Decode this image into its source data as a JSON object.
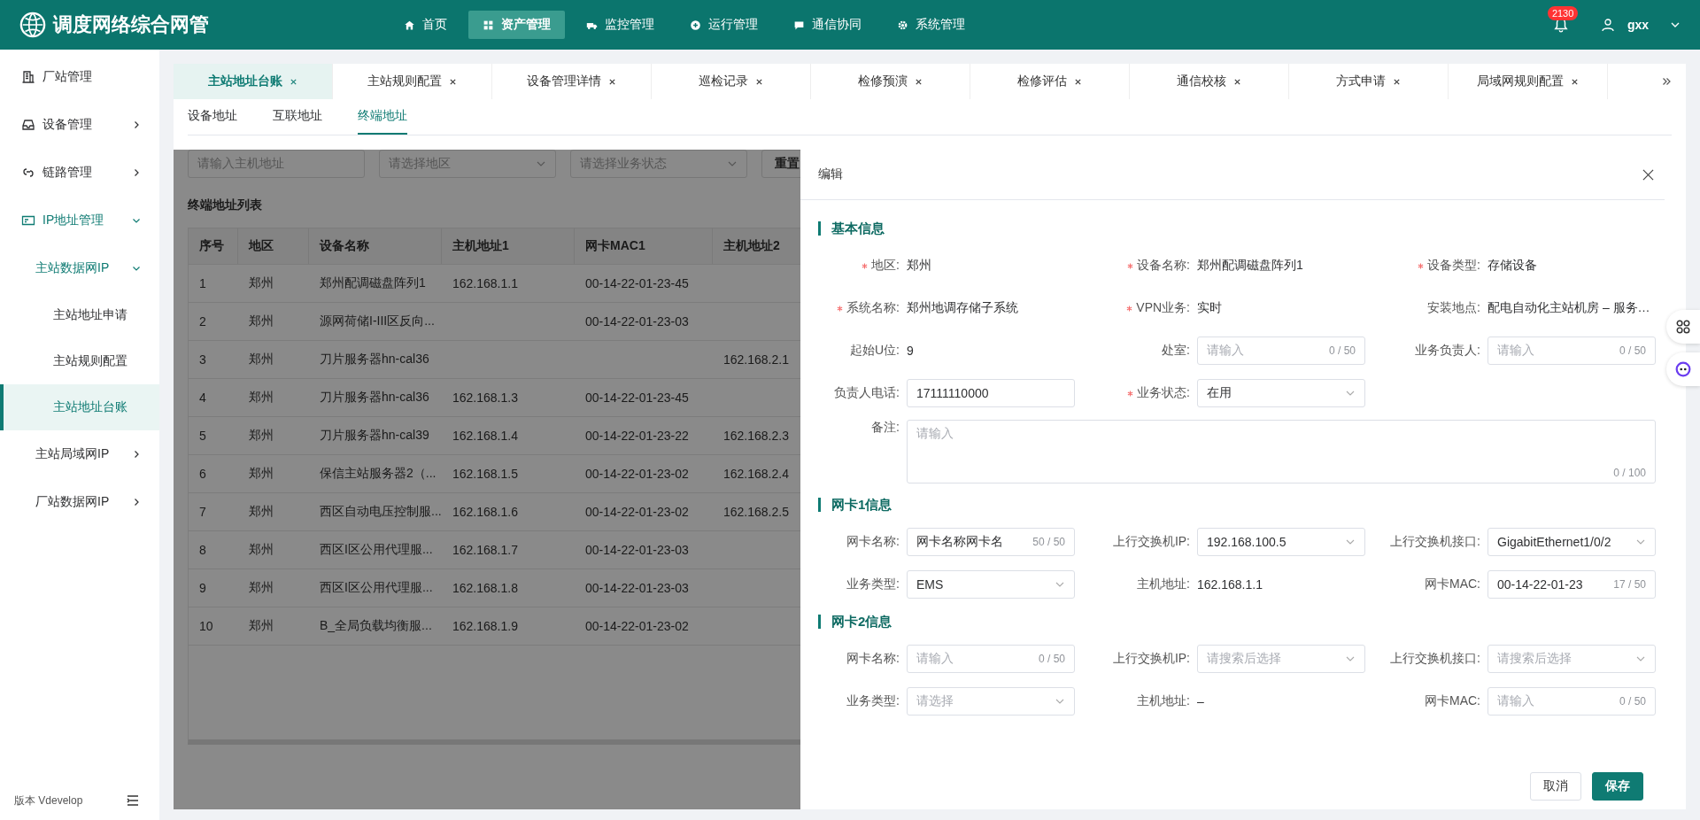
{
  "app": {
    "title": "调度网络综合网管"
  },
  "nav": [
    {
      "label": "首页",
      "selected": false
    },
    {
      "label": "资产管理",
      "selected": true
    },
    {
      "label": "监控管理",
      "selected": false
    },
    {
      "label": "运行管理",
      "selected": false
    },
    {
      "label": "通信协同",
      "selected": false
    },
    {
      "label": "系统管理",
      "selected": false
    }
  ],
  "header_right": {
    "badge": "2130",
    "user": "gxx"
  },
  "sidebar": {
    "items": [
      {
        "label": "厂站管理",
        "kind": "link",
        "selected": false
      },
      {
        "label": "设备管理",
        "kind": "group",
        "expanded": false,
        "selected": false
      },
      {
        "label": "链路管理",
        "kind": "group",
        "expanded": false,
        "selected": false
      },
      {
        "label": "IP地址管理",
        "kind": "group",
        "expanded": true,
        "selected": false,
        "children": [
          {
            "label": "主站数据网IP",
            "kind": "group",
            "expanded": true,
            "selected": false,
            "children": [
              {
                "label": "主站地址申请",
                "selected": false
              },
              {
                "label": "主站规则配置",
                "selected": false
              },
              {
                "label": "主站地址台账",
                "selected": true
              }
            ]
          },
          {
            "label": "主站局域网IP",
            "kind": "group",
            "expanded": false,
            "selected": false
          },
          {
            "label": "厂站数据网IP",
            "kind": "group",
            "expanded": false,
            "selected": false
          }
        ]
      }
    ],
    "version": "版本 Vdevelop"
  },
  "tabs": [
    {
      "label": "主站地址台账",
      "selected": true
    },
    {
      "label": "主站规则配置",
      "selected": false
    },
    {
      "label": "设备管理详情",
      "selected": false
    },
    {
      "label": "巡检记录",
      "selected": false
    },
    {
      "label": "检修预演",
      "selected": false
    },
    {
      "label": "检修评估",
      "selected": false
    },
    {
      "label": "通信校核",
      "selected": false
    },
    {
      "label": "方式申请",
      "selected": false
    },
    {
      "label": "局域网规则配置",
      "selected": false
    }
  ],
  "subtabs": [
    {
      "label": "设备地址",
      "selected": false
    },
    {
      "label": "互联地址",
      "selected": false
    },
    {
      "label": "终端地址",
      "selected": true
    }
  ],
  "filters": [
    {
      "kind": "input",
      "placeholder": "请输入主机地址"
    },
    {
      "kind": "select",
      "placeholder": "请选择地区"
    },
    {
      "kind": "select",
      "placeholder": "请选择业务状态"
    }
  ],
  "reset_button": "重置",
  "table": {
    "title": "终端地址列表",
    "columns": [
      "序号",
      "地区",
      "设备名称",
      "主机地址1",
      "网卡MAC1",
      "主机地址2"
    ],
    "rows": [
      [
        "1",
        "郑州",
        "郑州配调磁盘阵列1",
        "162.168.1.1",
        "00-14-22-01-23-45",
        null
      ],
      [
        "2",
        "郑州",
        "源网荷储I-III区反向...",
        null,
        "00-14-22-01-23-03",
        null
      ],
      [
        "3",
        "郑州",
        "刀片服务器hn-cal36",
        null,
        null,
        "162.168.2.1"
      ],
      [
        "4",
        "郑州",
        "刀片服务器hn-cal36",
        "162.168.1.3",
        "00-14-22-01-23-45",
        null
      ],
      [
        "5",
        "郑州",
        "刀片服务器hn-cal39",
        "162.168.1.4",
        "00-14-22-01-23-22",
        "162.168.2.3"
      ],
      [
        "6",
        "郑州",
        "保信主站服务器2（...",
        "162.168.1.5",
        "00-14-22-01-23-02",
        "162.168.2.4"
      ],
      [
        "7",
        "郑州",
        "西区自动电压控制服...",
        "162.168.1.6",
        "00-14-22-01-23-02",
        "162.168.2.5"
      ],
      [
        "8",
        "郑州",
        "西区I区公用代理服...",
        "162.168.1.7",
        "00-14-22-01-23-03",
        null
      ],
      [
        "9",
        "郑州",
        "西区I区公用代理服...",
        "162.168.1.8",
        "00-14-22-01-23-03",
        null
      ],
      [
        "10",
        "郑州",
        "B_全局负载均衡服...",
        "162.168.1.9",
        "00-14-22-01-23-02",
        null
      ]
    ]
  },
  "drawer": {
    "title": "编辑",
    "sections": [
      {
        "title": "基本信息",
        "fields": [
          {
            "label": "地区:",
            "required": true,
            "kind": "text",
            "value": "郑州"
          },
          {
            "label": "设备名称:",
            "required": true,
            "kind": "text",
            "value": "郑州配调磁盘阵列1"
          },
          {
            "label": "设备类型:",
            "required": true,
            "kind": "text",
            "value": "存储设备"
          },
          {
            "label": "系统名称:",
            "required": true,
            "kind": "text",
            "value": "郑州地调存储子系统"
          },
          {
            "label": "VPN业务:",
            "required": true,
            "kind": "text",
            "value": "实时"
          },
          {
            "label": "安装地点:",
            "required": false,
            "kind": "text",
            "value": "配电自动化主站机房 – 服务…"
          },
          {
            "label": "起始U位:",
            "required": false,
            "kind": "text",
            "value": "9"
          },
          {
            "label": "处室:",
            "required": false,
            "kind": "input",
            "placeholder": "请输入",
            "counter": "0 / 50"
          },
          {
            "label": "业务负责人:",
            "required": false,
            "kind": "input",
            "placeholder": "请输入",
            "counter": "0 / 50"
          },
          {
            "label": "负责人电话:",
            "required": false,
            "kind": "input",
            "value": "17111110000"
          },
          {
            "label": "业务状态:",
            "required": true,
            "kind": "select",
            "value": "在用"
          },
          {
            "label": "备注:",
            "required": false,
            "kind": "textarea",
            "placeholder": "请输入",
            "counter": "0 / 100"
          }
        ]
      },
      {
        "title": "网卡1信息",
        "fields": [
          {
            "label": "网卡名称:",
            "required": false,
            "kind": "input",
            "value": "网卡名称网卡名",
            "counter": "50 / 50"
          },
          {
            "label": "上行交换机IP:",
            "required": false,
            "kind": "select",
            "value": "192.168.100.5"
          },
          {
            "label": "上行交换机接口:",
            "required": false,
            "kind": "select",
            "value": "GigabitEthernet1/0/2"
          },
          {
            "label": "业务类型:",
            "required": false,
            "kind": "select",
            "value": "EMS"
          },
          {
            "label": "主机地址:",
            "required": false,
            "kind": "text",
            "value": "162.168.1.1"
          },
          {
            "label": "网卡MAC:",
            "required": false,
            "kind": "input",
            "value": "00-14-22-01-23",
            "counter": "17 / 50"
          }
        ]
      },
      {
        "title": "网卡2信息",
        "fields": [
          {
            "label": "网卡名称:",
            "required": false,
            "kind": "input",
            "placeholder": "请输入",
            "counter": "0 / 50"
          },
          {
            "label": "上行交换机IP:",
            "required": false,
            "kind": "select",
            "placeholder": "请搜索后选择"
          },
          {
            "label": "上行交换机接口:",
            "required": false,
            "kind": "select",
            "placeholder": "请搜索后选择"
          },
          {
            "label": "业务类型:",
            "required": false,
            "kind": "select",
            "placeholder": "请选择"
          },
          {
            "label": "主机地址:",
            "required": false,
            "kind": "text",
            "value": "–"
          },
          {
            "label": "网卡MAC:",
            "required": false,
            "kind": "input",
            "placeholder": "请输入",
            "counter": "0 / 50"
          }
        ]
      }
    ],
    "buttons": [
      {
        "label": "取消",
        "kind": "secondary"
      },
      {
        "label": "保存",
        "kind": "primary"
      }
    ]
  }
}
